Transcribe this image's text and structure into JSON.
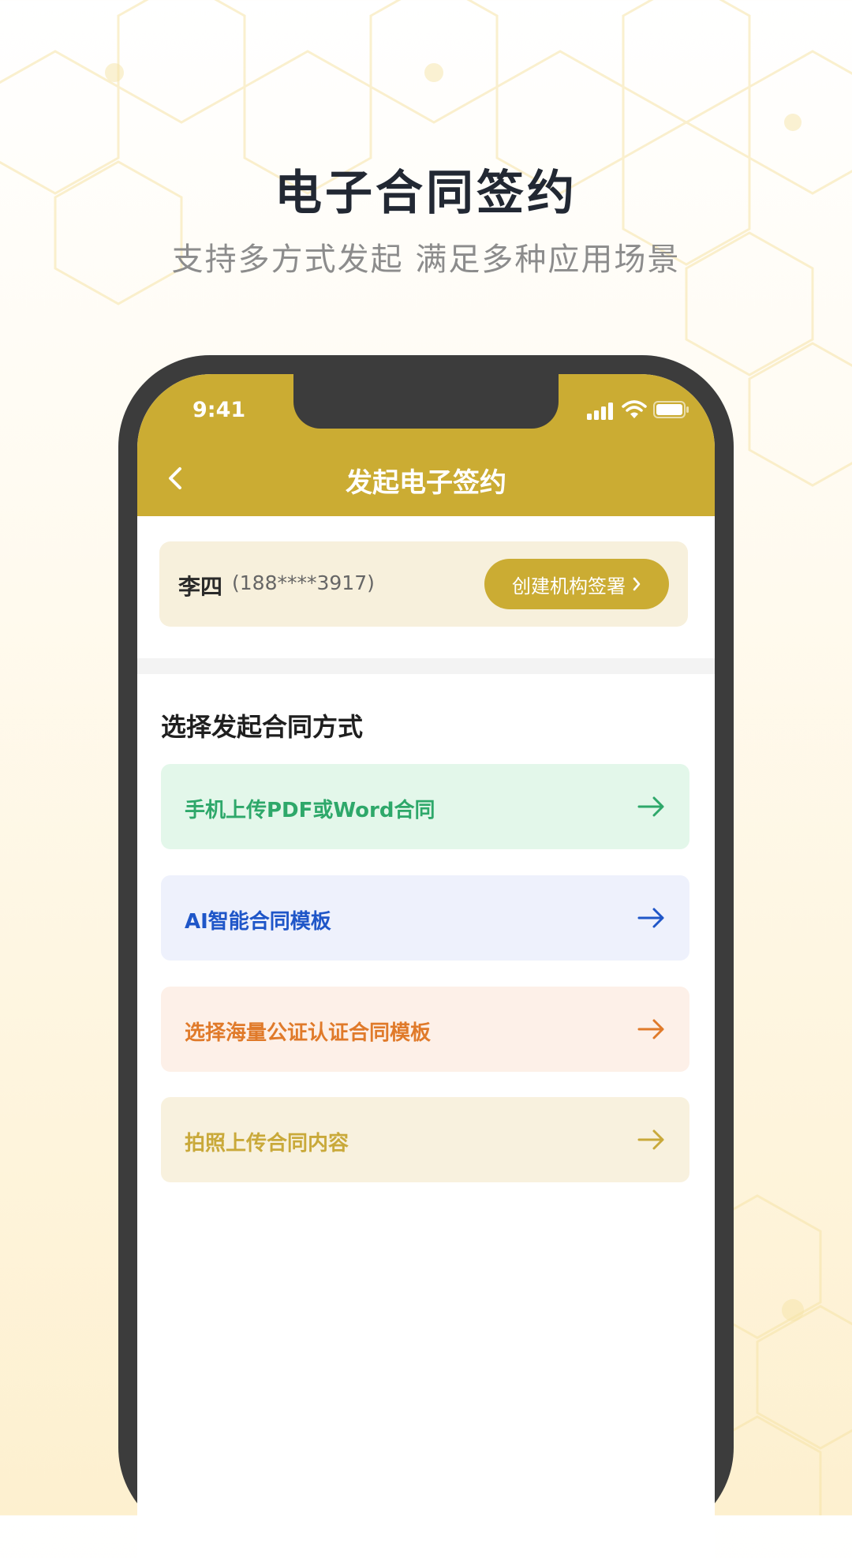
{
  "promo": {
    "title": "电子合同签约",
    "subtitle": "支持多方式发起  满足多种应用场景"
  },
  "status_bar": {
    "time": "9:41",
    "icons": [
      "signal-icon",
      "wifi-icon",
      "battery-icon"
    ]
  },
  "nav": {
    "back_icon": "chevron-left-icon",
    "title": "发起电子签约"
  },
  "user": {
    "name": "李四",
    "phone": "(188****3917)",
    "org_button": "创建机构签署"
  },
  "section": {
    "title": "选择发起合同方式"
  },
  "options": [
    {
      "label": "手机上传PDF或Word合同",
      "text_color": "#2ea86a",
      "bg_color": "#e3f7ea"
    },
    {
      "label": "AI智能合同模板",
      "text_color": "#1f56c8",
      "bg_color": "#eef1fc"
    },
    {
      "label": "选择海量公证认证合同模板",
      "text_color": "#e07a2a",
      "bg_color": "#fdf0e8"
    },
    {
      "label": "拍照上传合同内容",
      "text_color": "#c9a93a",
      "bg_color": "#f8f1de"
    }
  ],
  "colors": {
    "accent": "#cbac33",
    "phone_frame": "#3c3c3c"
  }
}
